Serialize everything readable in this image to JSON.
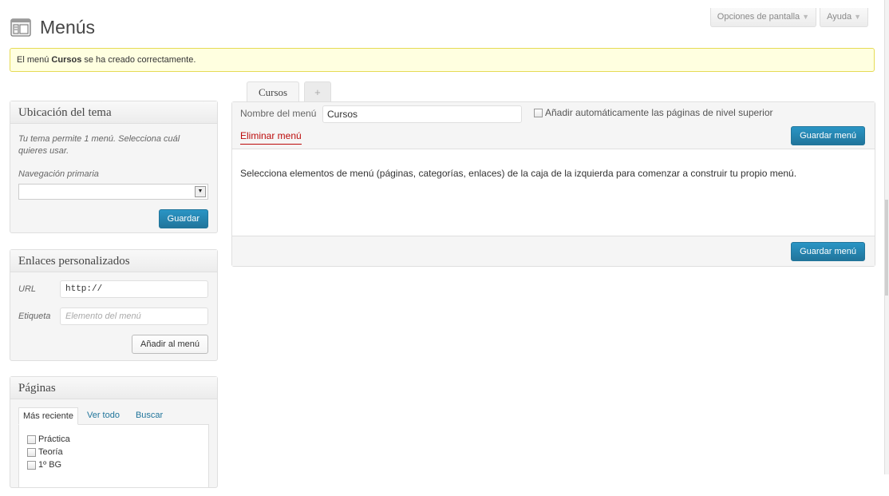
{
  "header": {
    "title": "Menús",
    "screen_options": "Opciones de pantalla",
    "help": "Ayuda",
    "arrow": "▼"
  },
  "notice": {
    "prefix": "El menú ",
    "name": "Cursos",
    "suffix": " se ha creado correctamente."
  },
  "theme_location": {
    "title": "Ubicación del tema",
    "description": "Tu tema permite 1 menú. Selecciona cuál quieres usar.",
    "field_label": "Navegación primaria",
    "selected": "",
    "save": "Guardar"
  },
  "custom_links": {
    "title": "Enlaces personalizados",
    "url_label": "URL",
    "url_value": "http://",
    "label_label": "Etiqueta",
    "label_placeholder": "Elemento del menú",
    "add": "Añadir al menú"
  },
  "pages": {
    "title": "Páginas",
    "tabs": [
      "Más reciente",
      "Ver todo",
      "Buscar"
    ],
    "items": [
      "Práctica",
      "Teoría",
      "1º BG"
    ]
  },
  "menu_tabs": {
    "active": "Cursos",
    "plus": "+"
  },
  "editor": {
    "name_label": "Nombre del menú",
    "name_value": "Cursos",
    "auto_add": "Añadir automáticamente las páginas de nivel superior",
    "delete": "Eliminar menú",
    "save": "Guardar menú",
    "body": "Selecciona elementos de menú (páginas, categorías, enlaces) de la caja de la izquierda para comenzar a construir tu propio menú."
  },
  "colors": {
    "primary": "#21759b",
    "notice_bg": "#ffffe0",
    "delete": "#bc0b0b"
  }
}
